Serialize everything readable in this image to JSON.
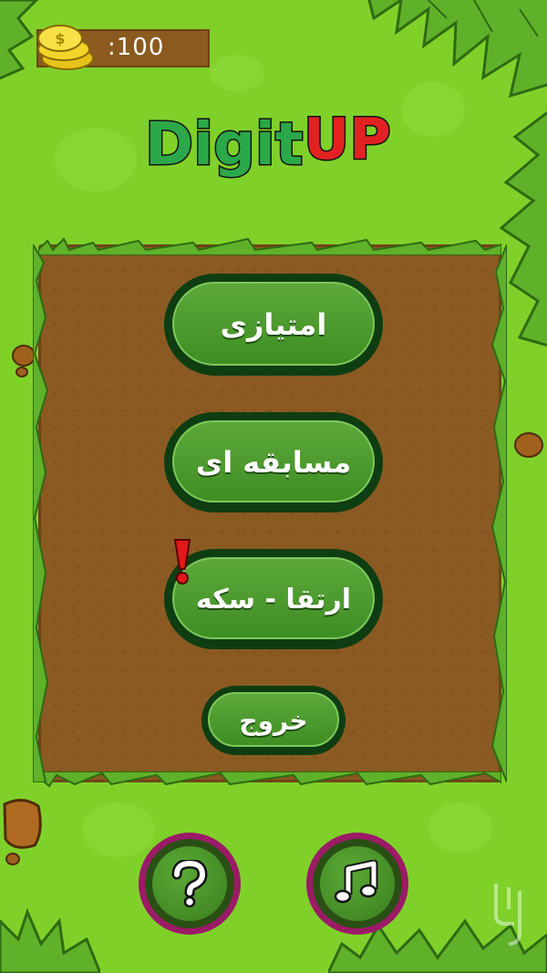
{
  "coins": {
    "label": ":100"
  },
  "logo": {
    "part1": "Digit",
    "part2": "UP"
  },
  "menu": {
    "score_mode": "امتیازی",
    "competition_mode": "مسابقه ای",
    "upgrade_coin": "ارتقا - سکه",
    "exit": "خروج"
  },
  "icons": {
    "coin": "coin-stack-icon",
    "alert": "exclamation-icon",
    "help": "question-mark-icon",
    "music": "music-note-icon"
  },
  "colors": {
    "grass": "#7fd12a",
    "dirt": "#8b5a23",
    "button_green": "#4c9a2d",
    "button_border": "#0f3d12",
    "round_ring": "#9b1b66",
    "alert_red": "#e01a1a"
  }
}
